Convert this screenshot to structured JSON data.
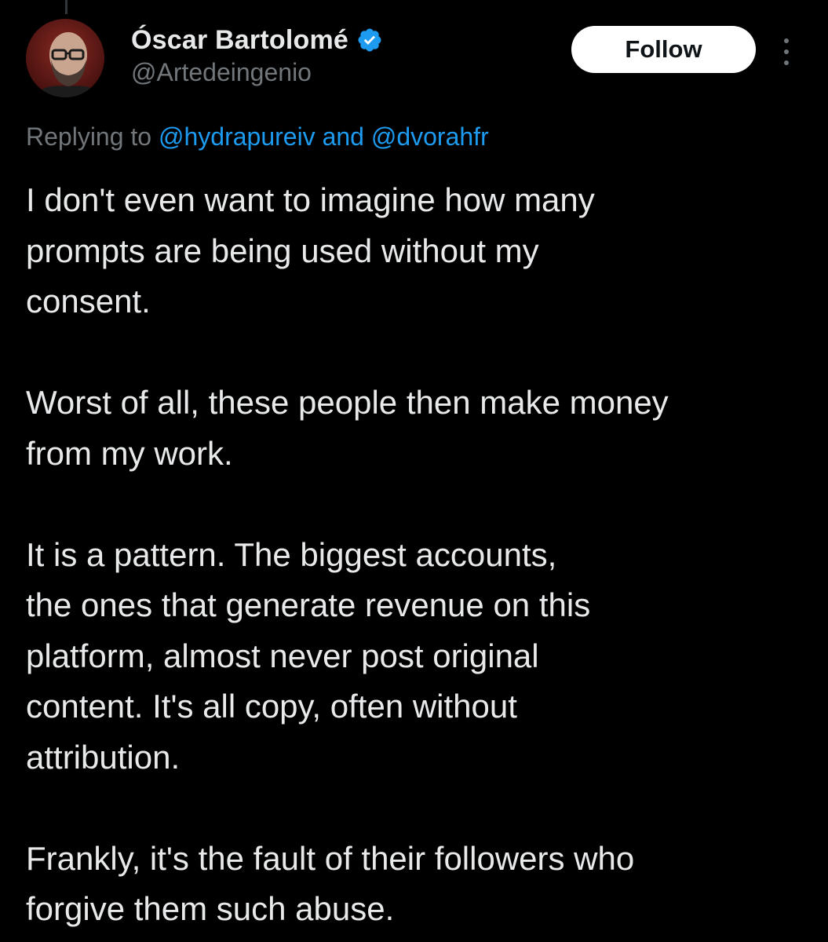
{
  "author": {
    "display_name": "Óscar Bartolomé",
    "handle": "@Artedeingenio",
    "verified": true,
    "avatar_icon": "user-avatar-icon"
  },
  "actions": {
    "follow_label": "Follow",
    "more_icon": "more-vertical-icon"
  },
  "reply_context": {
    "prefix": "Replying to ",
    "mention_1": "@hydrapureiv",
    "connector": " and ",
    "mention_2": "@dvorahfr"
  },
  "tweet": {
    "paragraphs": [
      "I don't even want to imagine how many\nprompts are being used without my\nconsent.",
      "Worst of all, these people then make money\nfrom my work.",
      "It is a pattern. The biggest accounts,\nthe ones that generate revenue on this\nplatform, almost never post original\ncontent. It's all copy, often without\nattribution.",
      "Frankly, it's the fault of their followers who\nforgive them such abuse."
    ]
  },
  "colors": {
    "background": "#000000",
    "text": "#e7e9ea",
    "secondary_text": "#71767b",
    "link": "#1d9bf0",
    "verified_badge": "#1d9bf0",
    "follow_button_bg": "#ffffff"
  }
}
